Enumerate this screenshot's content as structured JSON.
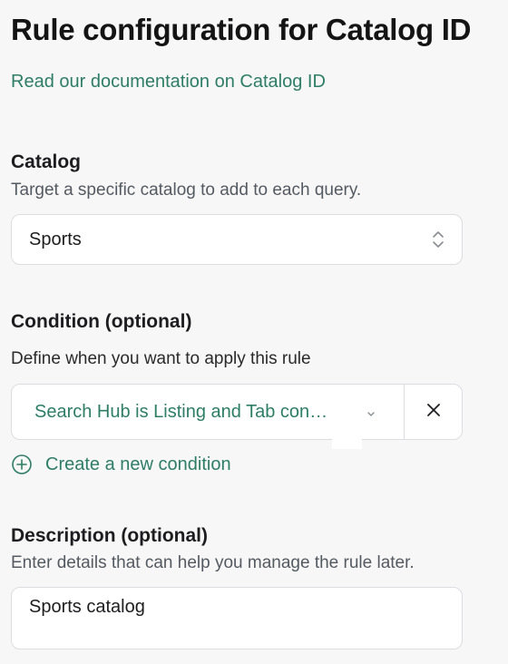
{
  "header": {
    "title": "Rule configuration for Catalog ID",
    "doc_link": "Read our documentation on Catalog ID"
  },
  "catalog": {
    "label": "Catalog",
    "help": "Target a specific catalog to add to each query.",
    "selected": "Sports"
  },
  "condition": {
    "label": "Condition (optional)",
    "help": "Define when you want to apply this rule",
    "value": "Search Hub is Listing and Tab con…",
    "create_label": "Create a new condition"
  },
  "description": {
    "label": "Description (optional)",
    "help": "Enter details that can help you manage the rule later.",
    "value": "Sports catalog"
  },
  "colors": {
    "accent": "#2e7d65",
    "background": "#f7f7f8",
    "border": "#dcdde0"
  }
}
